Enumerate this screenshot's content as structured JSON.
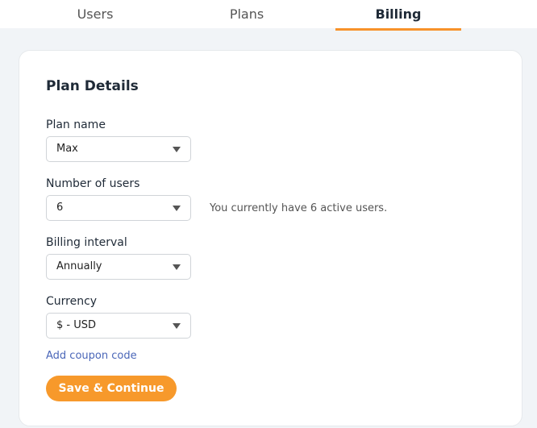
{
  "tabs": [
    {
      "label": "Users"
    },
    {
      "label": "Plans"
    },
    {
      "label": "Billing",
      "active": true
    }
  ],
  "section_title": "Plan Details",
  "fields": [
    {
      "label": "Plan name",
      "value": "Max"
    },
    {
      "label": "Number of users",
      "value": "6"
    },
    {
      "label": "Billing interval",
      "value": "Annually"
    },
    {
      "label": "Currency",
      "value": "$ - USD"
    }
  ],
  "users_hint": "You currently have 6 active users.",
  "coupon_link": "Add coupon code",
  "submit_label": "Save & Continue",
  "colors": {
    "accent": "#f7992b",
    "link": "#4a66b8",
    "background": "#f1f4f7"
  }
}
